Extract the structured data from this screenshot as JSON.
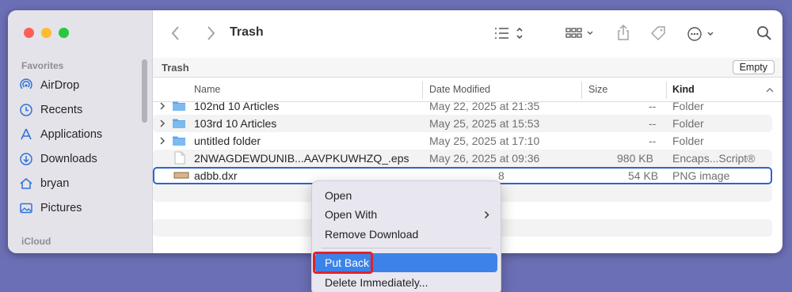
{
  "window": {
    "title": "Trash"
  },
  "sidebar": {
    "favorites_label": "Favorites",
    "icloud_label": "iCloud",
    "items": [
      {
        "label": "AirDrop",
        "icon": "airdrop-icon"
      },
      {
        "label": "Recents",
        "icon": "clock-icon"
      },
      {
        "label": "Applications",
        "icon": "applications-icon"
      },
      {
        "label": "Downloads",
        "icon": "download-icon"
      },
      {
        "label": "bryan",
        "icon": "home-icon"
      },
      {
        "label": "Pictures",
        "icon": "pictures-icon"
      }
    ]
  },
  "toolbar": {
    "title": "Trash"
  },
  "pathbar": {
    "label": "Trash",
    "empty_button": "Empty"
  },
  "columns": {
    "name": "Name",
    "date": "Date Modified",
    "size": "Size",
    "kind": "Kind"
  },
  "files": [
    {
      "name": "102nd 10 Articles",
      "date": "May 22, 2025 at 21:35",
      "size": "--",
      "kind": "Folder",
      "type": "folder"
    },
    {
      "name": "103rd 10 Articles",
      "date": "May 25, 2025 at 15:53",
      "size": "--",
      "kind": "Folder",
      "type": "folder"
    },
    {
      "name": "untitled folder",
      "date": "May 25, 2025 at 17:10",
      "size": "--",
      "kind": "Folder",
      "type": "folder"
    },
    {
      "name": "2NWAGDEWDUNIB...AAVPKUWHZQ_.eps",
      "date": "May 26, 2025 at 09:36",
      "size": "980 KB",
      "kind": "Encaps...Script®",
      "type": "document"
    },
    {
      "name": "adbb.dxr",
      "date": "8",
      "size": "54 KB",
      "kind": "PNG image",
      "type": "image"
    }
  ],
  "context_menu": {
    "open": "Open",
    "open_with": "Open With",
    "remove_download": "Remove Download",
    "put_back": "Put Back",
    "delete_immediately": "Delete Immediately..."
  },
  "colors": {
    "accent": "#3d82e8",
    "selection": "#2f63cf",
    "highlight_box": "#e0222a",
    "folder": "#5aa6e8"
  }
}
